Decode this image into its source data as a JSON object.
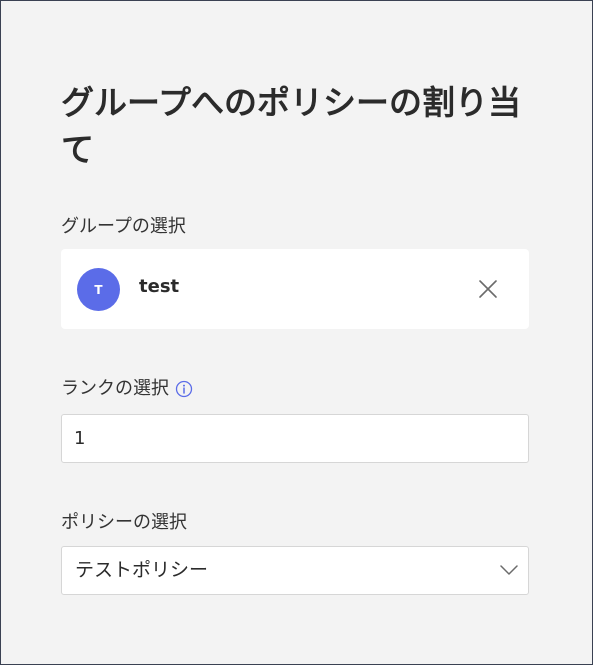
{
  "panel": {
    "title": "グループへのポリシーの割り当て"
  },
  "group_section": {
    "label": "グループの選択",
    "selected_group": {
      "initial": "T",
      "name": "test",
      "avatar_color": "#5b6ce8"
    }
  },
  "rank_section": {
    "label": "ランクの選択",
    "info_icon": "info-icon",
    "value": "1"
  },
  "policy_section": {
    "label": "ポリシーの選択",
    "selected": "テストポリシー",
    "icon": "chevron-down-icon"
  }
}
